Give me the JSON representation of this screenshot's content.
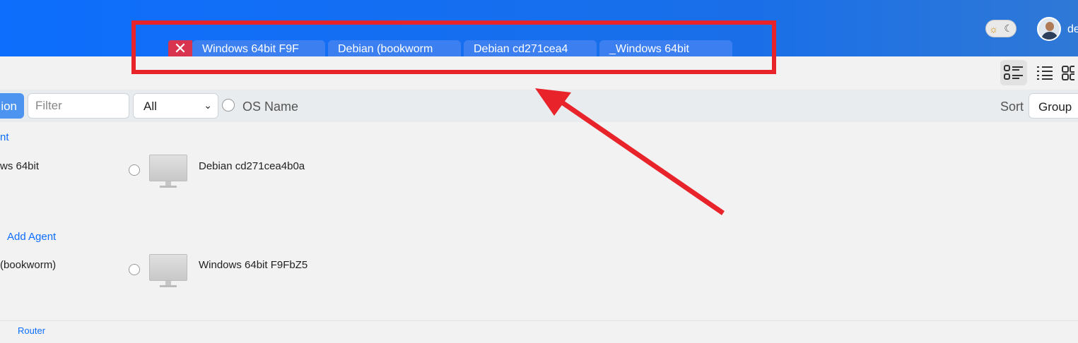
{
  "header": {
    "close_tab_label": "✕",
    "tabs": [
      "Windows 64bit F9F",
      "Debian (bookworm",
      "Debian cd271cea4",
      "_Windows 64bit"
    ],
    "user_name": "de"
  },
  "toolbar": {
    "action_label": "ion",
    "filter_placeholder": "Filter",
    "select_value": "All",
    "os_name_label": "OS Name",
    "sort_label": "Sort",
    "group_label": "Group"
  },
  "groups": [
    {
      "link": "nt",
      "left_agent": "ws 64bit",
      "agent": "Debian cd271cea4b0a"
    },
    {
      "link": "Add Agent",
      "left_agent": "(bookworm)",
      "agent": "Windows 64bit F9FbZ5"
    }
  ],
  "footer": {
    "router_link": "Router"
  },
  "colors": {
    "header_blue": "#0d6efd",
    "highlight_red": "#e8232a",
    "close_red": "#d9344f"
  }
}
